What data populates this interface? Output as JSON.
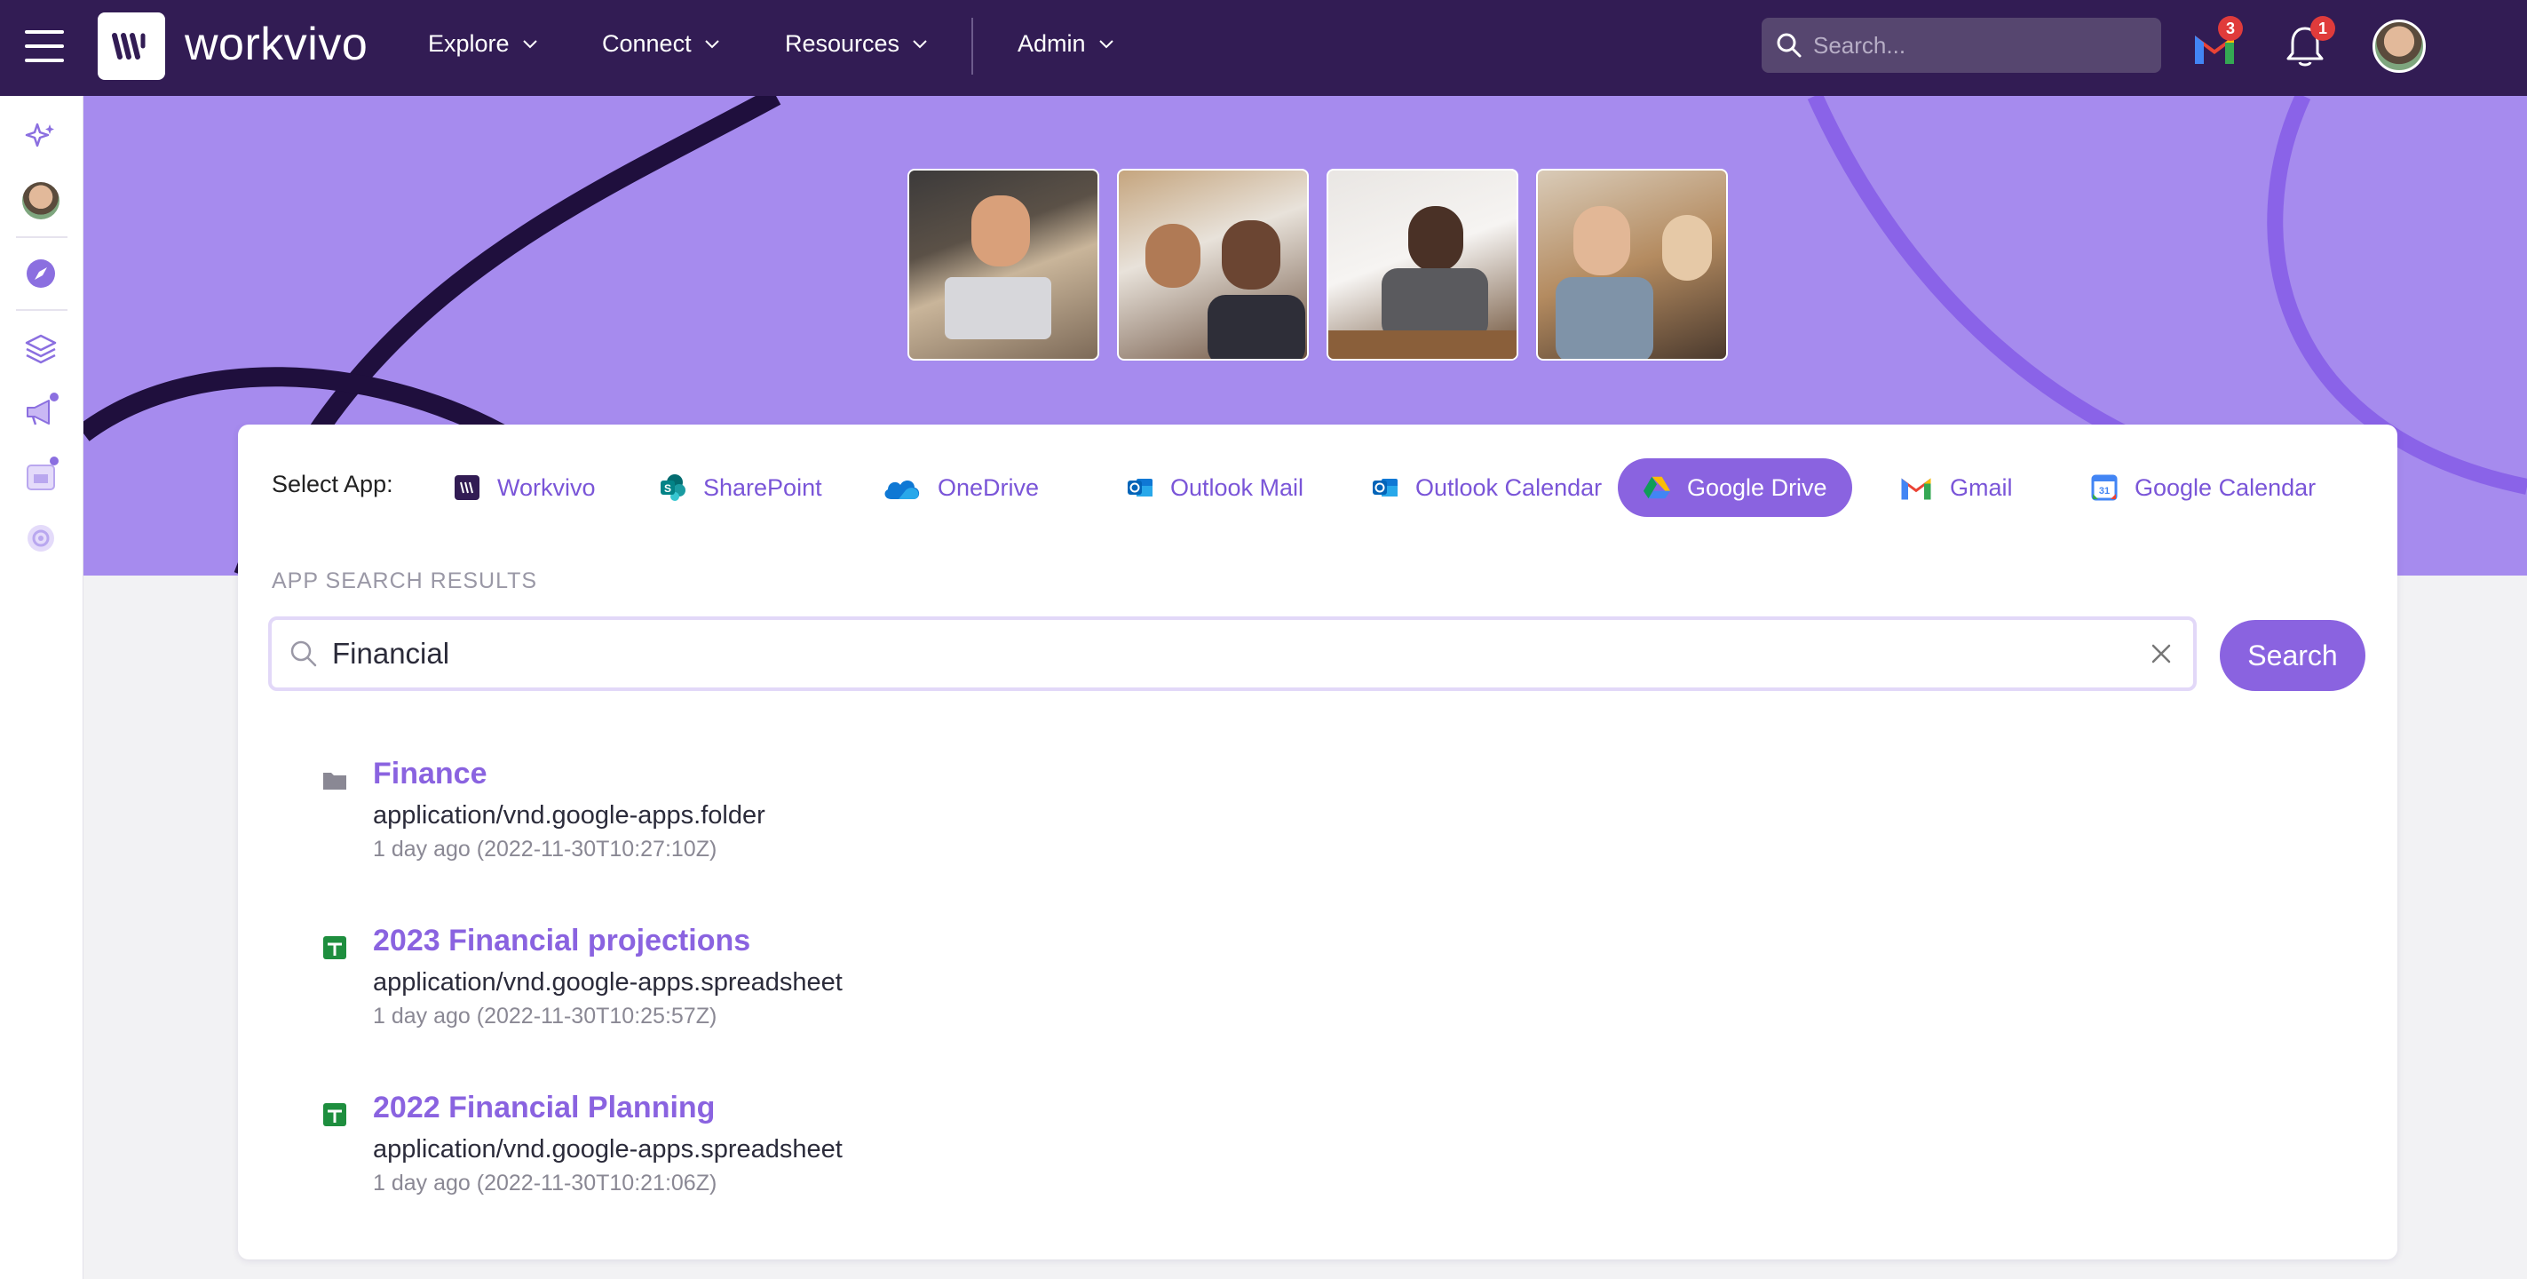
{
  "topnav": {
    "brand": "workvivo",
    "menus": [
      {
        "label": "Explore"
      },
      {
        "label": "Connect"
      },
      {
        "label": "Resources"
      },
      {
        "label": "Admin"
      }
    ],
    "search_placeholder": "Search...",
    "gmail_badge": "3",
    "notifications_badge": "1"
  },
  "sidebar": {
    "icons": [
      "sparkle-icon",
      "user-avatar",
      "compass-icon",
      "layers-icon",
      "megaphone-icon",
      "calendar-icon",
      "settings-icon"
    ]
  },
  "hero": {
    "photos": [
      "photo-man-laptop",
      "photo-two-women-laughing",
      "photo-woman-writing",
      "photo-women-colleagues"
    ]
  },
  "apps": {
    "select_label": "Select App:",
    "tabs": [
      {
        "label": "Workvivo",
        "icon": "workvivo-icon"
      },
      {
        "label": "SharePoint",
        "icon": "sharepoint-icon"
      },
      {
        "label": "OneDrive",
        "icon": "onedrive-icon"
      },
      {
        "label": "Outlook Mail",
        "icon": "outlook-icon"
      },
      {
        "label": "Outlook Calendar",
        "icon": "outlook-calendar-icon"
      },
      {
        "label": "Google Drive",
        "icon": "google-drive-icon",
        "active": true
      },
      {
        "label": "Gmail",
        "icon": "gmail-icon"
      },
      {
        "label": "Google Calendar",
        "icon": "google-calendar-icon"
      }
    ]
  },
  "results_section": {
    "label": "APP SEARCH RESULTS",
    "query": "Financial",
    "search_button": "Search",
    "items": [
      {
        "title": "Finance",
        "type": "application/vnd.google-apps.folder",
        "time": "1 day ago (2022-11-30T10:27:10Z)",
        "icon": "folder-icon"
      },
      {
        "title": "2023 Financial projections",
        "type": "application/vnd.google-apps.spreadsheet",
        "time": "1 day ago (2022-11-30T10:25:57Z)",
        "icon": "spreadsheet-icon"
      },
      {
        "title": "2022 Financial Planning",
        "type": "application/vnd.google-apps.spreadsheet",
        "time": "1 day ago (2022-11-30T10:21:06Z)",
        "icon": "spreadsheet-icon"
      }
    ]
  },
  "colors": {
    "nav_bg": "#321c54",
    "hero_bg": "#a68bee",
    "accent": "#8a63e0",
    "badge": "#e03b3b"
  }
}
